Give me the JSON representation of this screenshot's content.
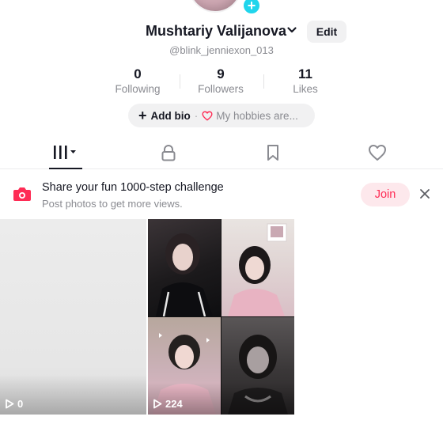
{
  "profile": {
    "username": "Mushtariy Valijanova",
    "handle": "@blink_jenniexon_013",
    "edit_label": "Edit"
  },
  "stats": [
    {
      "value": "0",
      "label": "Following"
    },
    {
      "value": "9",
      "label": "Followers"
    },
    {
      "value": "11",
      "label": "Likes"
    }
  ],
  "bio": {
    "add_label": "Add bio",
    "separator": "·",
    "hobbies_label": "My hobbies are..."
  },
  "tabs": [
    {
      "icon": "videos-grid-icon",
      "active": true
    },
    {
      "icon": "lock-icon",
      "active": false
    },
    {
      "icon": "bookmark-icon",
      "active": false
    },
    {
      "icon": "heart-icon",
      "active": false
    }
  ],
  "challenge": {
    "title": "Share your fun 1000-step challenge",
    "subtitle": "Post photos to get more views.",
    "join_label": "Join",
    "accent": "#fe2c55"
  },
  "videos": [
    {
      "views": "0"
    },
    {
      "views": "224"
    }
  ],
  "colors": {
    "text": "#161823",
    "muted": "#8a8b91",
    "pill_bg": "#f1f1f2",
    "avatar_add": "#20d5ec",
    "join_bg": "#fde8ec"
  }
}
